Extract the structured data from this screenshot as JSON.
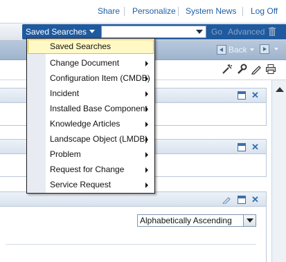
{
  "top_links": [
    "Share",
    "Personalize",
    "System News",
    "Log Off"
  ],
  "search": {
    "saved_searches_label": "Saved Searches",
    "go_label": "Go",
    "advanced_label": "Advanced"
  },
  "nav": {
    "back_label": "Back"
  },
  "saved_searches_menu": {
    "selected": "Saved Searches",
    "items": [
      "Change Document",
      "Configuration Item (CMDB)",
      "Incident",
      "Installed Base Component",
      "Knowledge Articles",
      "Landscape Object (LMDB)",
      "Problem",
      "Request for Change",
      "Service Request"
    ]
  },
  "sort_select": {
    "value": "Alphabetically Ascending"
  },
  "icons": [
    "trash-icon",
    "back-arrow-icon",
    "forward-arrow-icon",
    "personalize-icon",
    "settings-icon",
    "edit-icon",
    "print-icon",
    "minimize-icon",
    "close-icon"
  ]
}
